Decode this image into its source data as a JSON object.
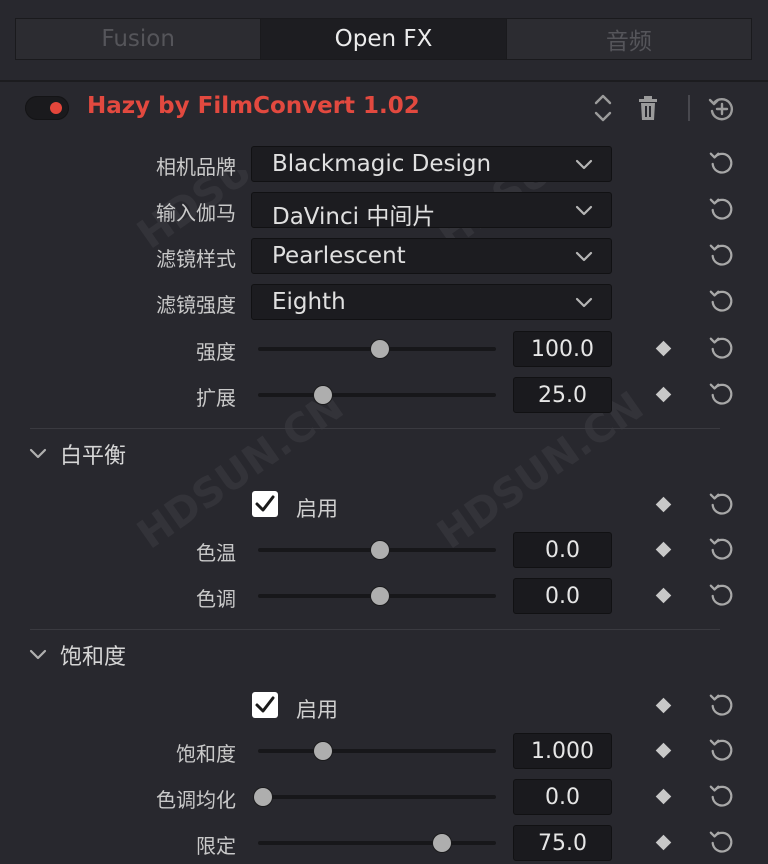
{
  "tabs": [
    {
      "label": "Fusion",
      "active": false
    },
    {
      "label": "Open FX",
      "active": true
    },
    {
      "label": "音频",
      "active": false
    }
  ],
  "plugin": {
    "title": "Hazy by FilmConvert 1.02",
    "enabled": true,
    "accent_color": "#e2493f"
  },
  "params": {
    "camera_brand": {
      "label": "相机品牌",
      "value": "Blackmagic Design"
    },
    "input_gamma": {
      "label": "输入伽马",
      "value": "DaVinci 中间片"
    },
    "filter_style": {
      "label": "滤镜样式",
      "value": "Pearlescent"
    },
    "filter_strength": {
      "label": "滤镜强度",
      "value": "Eighth"
    },
    "strength": {
      "label": "强度",
      "value": "100.0",
      "slider_fraction": 0.5
    },
    "spread": {
      "label": "扩展",
      "value": "25.0",
      "slider_fraction": 0.26
    }
  },
  "white_balance": {
    "title": "白平衡",
    "enable_label": "启用",
    "enabled": true,
    "temperature": {
      "label": "色温",
      "value": "0.0",
      "slider_fraction": 0.5
    },
    "tint": {
      "label": "色调",
      "value": "0.0",
      "slider_fraction": 0.5
    }
  },
  "saturation": {
    "title": "饱和度",
    "enable_label": "启用",
    "enabled": true,
    "saturation": {
      "label": "饱和度",
      "value": "1.000",
      "slider_fraction": 0.26
    },
    "tone_equalize": {
      "label": "色调均化",
      "value": "0.0",
      "slider_fraction": 0.01
    },
    "limit": {
      "label": "限定",
      "value": "75.0",
      "slider_fraction": 0.76
    }
  },
  "icons": [
    "expand-collapse-icon",
    "trash-icon",
    "reset-all-icon",
    "reset-icon",
    "keyframe-icon",
    "chevron-down-icon",
    "checkmark-icon",
    "section-chevron-icon"
  ]
}
